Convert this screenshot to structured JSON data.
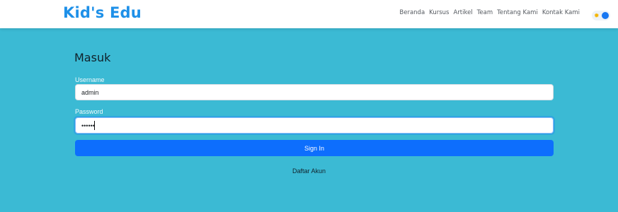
{
  "navbar": {
    "brand": "Kid's Edu",
    "links": [
      "Beranda",
      "Kursus",
      "Artikel",
      "Team",
      "Tentang Kami",
      "Kontak Kami"
    ],
    "theme_toggle": {
      "icon": "sun-icon",
      "accent": "#1877f2",
      "sun_color": "#f4b400"
    }
  },
  "form": {
    "title": "Masuk",
    "username_label": "Username",
    "username_value": "admin",
    "password_label": "Password",
    "password_value": "••••••",
    "submit_label": "Sign In",
    "register_link": "Daftar Akun"
  },
  "colors": {
    "page_background": "#3bbad4",
    "brand": "#1e90e8",
    "primary_button": "#0d6efd"
  }
}
